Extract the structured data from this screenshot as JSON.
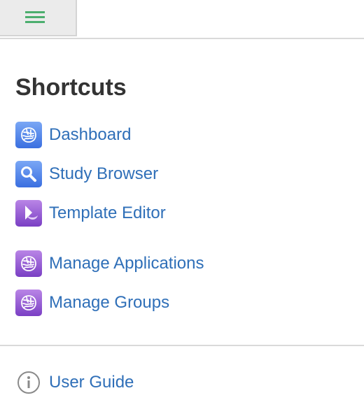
{
  "header": {
    "menu_icon": "hamburger-menu-icon",
    "menu_icon_color": "#4cae6e"
  },
  "shortcuts": {
    "title": "Shortcuts",
    "items": [
      {
        "label": "Dashboard",
        "icon": "brain-logo-icon",
        "icon_color": "blue"
      },
      {
        "label": "Study Browser",
        "icon": "magnifier-icon",
        "icon_color": "blue"
      },
      {
        "label": "Template Editor",
        "icon": "template-editor-icon",
        "icon_color": "purple"
      },
      {
        "label": "Manage Applications",
        "icon": "brain-logo-icon",
        "icon_color": "purple"
      },
      {
        "label": "Manage Groups",
        "icon": "brain-logo-icon",
        "icon_color": "purple"
      }
    ]
  },
  "help": {
    "user_guide_label": "User Guide",
    "icon": "info-circle-icon"
  },
  "colors": {
    "link": "#2f6fb8",
    "heading": "#333333",
    "divider": "#d9d9d9"
  }
}
